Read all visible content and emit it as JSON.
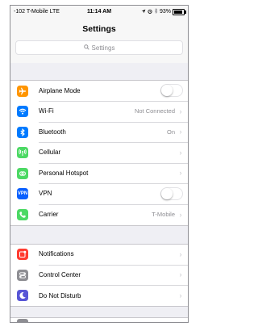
{
  "status_bar": {
    "carrier": "-102 T-Mobile  LTE",
    "time": "11:14 AM",
    "battery": "93%",
    "battery_level": 0.93
  },
  "nav": {
    "title": "Settings"
  },
  "search": {
    "placeholder": "Settings"
  },
  "group1": [
    {
      "label": "Airplane Mode",
      "icon": "airplane-icon",
      "color": "#ff9500",
      "accessory": "toggle",
      "toggle_on": false
    },
    {
      "label": "Wi-Fi",
      "icon": "wifi-icon",
      "color": "#007aff",
      "value": "Not Connected",
      "accessory": "chevron"
    },
    {
      "label": "Bluetooth",
      "icon": "bluetooth-icon",
      "color": "#007aff",
      "value": "On",
      "accessory": "chevron"
    },
    {
      "label": "Cellular",
      "icon": "cellular-icon",
      "color": "#4cd964",
      "accessory": "chevron"
    },
    {
      "label": "Personal Hotspot",
      "icon": "hotspot-icon",
      "color": "#4cd964",
      "accessory": "chevron"
    },
    {
      "label": "VPN",
      "icon": "vpn-icon",
      "color": "#0a60ff",
      "icon_text": "VPN",
      "accessory": "toggle",
      "toggle_on": false
    },
    {
      "label": "Carrier",
      "icon": "phone-icon",
      "color": "#4cd964",
      "value": "T-Mobile",
      "accessory": "chevron"
    }
  ],
  "group2": [
    {
      "label": "Notifications",
      "icon": "notifications-icon",
      "color": "#ff3b30",
      "accessory": "chevron"
    },
    {
      "label": "Control Center",
      "icon": "control-center-icon",
      "color": "#8e8e93",
      "accessory": "chevron"
    },
    {
      "label": "Do Not Disturb",
      "icon": "moon-icon",
      "color": "#5856d6",
      "accessory": "chevron"
    }
  ],
  "chevron_glyph": "›"
}
